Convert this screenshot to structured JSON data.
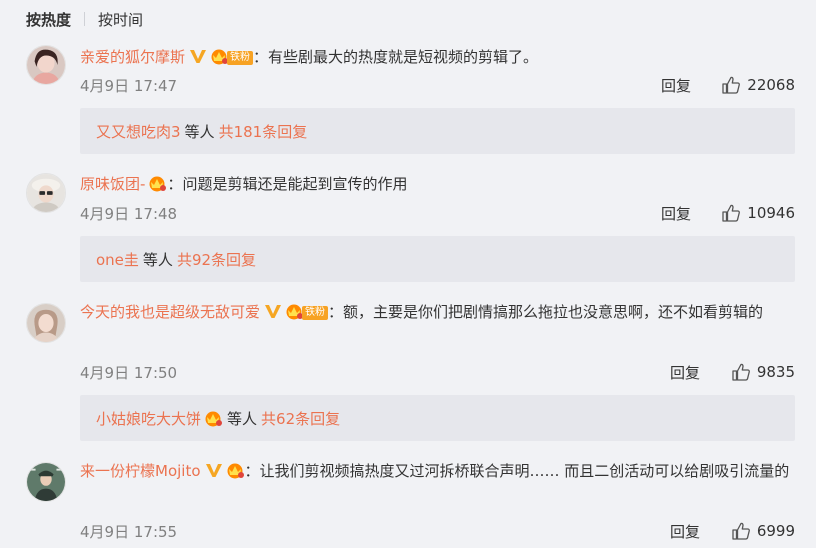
{
  "sort": {
    "hot": "按热度",
    "time": "按时间"
  },
  "colors": {
    "accent": "#eb7350",
    "meta": "#808080",
    "fan_badge": "#f7a223",
    "vip": "#f5a623"
  },
  "comments": [
    {
      "username": "亲爱的狐尔摩斯",
      "verified": true,
      "crown": true,
      "fan_badge": "铁粉",
      "colon": "：",
      "text": "有些剧最大的热度就是短视频的剪辑了。",
      "time": "4月9日 17:47",
      "reply_label": "回复",
      "likes": "22068",
      "sub": {
        "user": "又又想吃肉3",
        "etc": "等人",
        "count": "共181条回复"
      }
    },
    {
      "username": "原味饭团-",
      "verified": false,
      "crown": true,
      "fan_badge": "",
      "colon": "：",
      "text": "问题是剪辑还是能起到宣传的作用",
      "time": "4月9日 17:48",
      "reply_label": "回复",
      "likes": "10946",
      "sub": {
        "user": "one圭",
        "etc": "等人",
        "count": "共92条回复"
      }
    },
    {
      "username": "今天的我也是超级无敌可爱",
      "verified": true,
      "crown": true,
      "fan_badge": "铁粉",
      "colon": "：",
      "text": "额，主要是你们把剧情搞那么拖拉也没意思啊，还不如看剪辑的",
      "time": "4月9日 17:50",
      "reply_label": "回复",
      "likes": "9835",
      "sub": {
        "user": "小姑娘吃大大饼",
        "etc": "等人",
        "count": "共62条回复"
      }
    },
    {
      "username": "来一份柠檬Mojito",
      "verified": true,
      "crown": true,
      "fan_badge": "",
      "colon": "：",
      "text": "让我们剪视频搞热度又过河拆桥联合声明…… 而且二创活动可以给剧吸引流量的",
      "time": "4月9日 17:55",
      "reply_label": "回复",
      "likes": "6999"
    }
  ]
}
